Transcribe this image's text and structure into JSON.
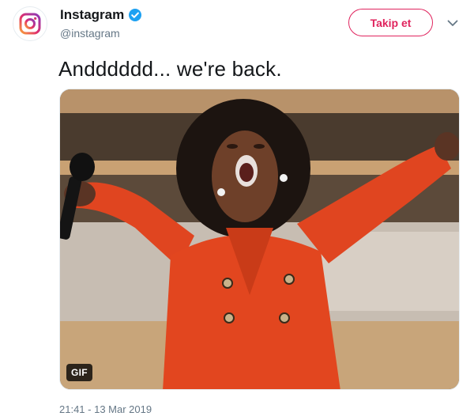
{
  "tweet": {
    "author": {
      "display_name": "Instagram",
      "handle": "@instagram",
      "verified": true,
      "avatar_icon": "instagram-logo-icon"
    },
    "follow_button_label": "Takip et",
    "more_menu_icon": "chevron-down-icon",
    "text": "Andddddd... we're back.",
    "media": {
      "type": "gif",
      "badge_label": "GIF"
    },
    "timestamp": "21:41 - 13 Mar 2019"
  },
  "colors": {
    "brand_accent": "#e0245e",
    "verified_blue": "#1da1f2",
    "text_primary": "#14171a",
    "text_secondary": "#657786"
  }
}
